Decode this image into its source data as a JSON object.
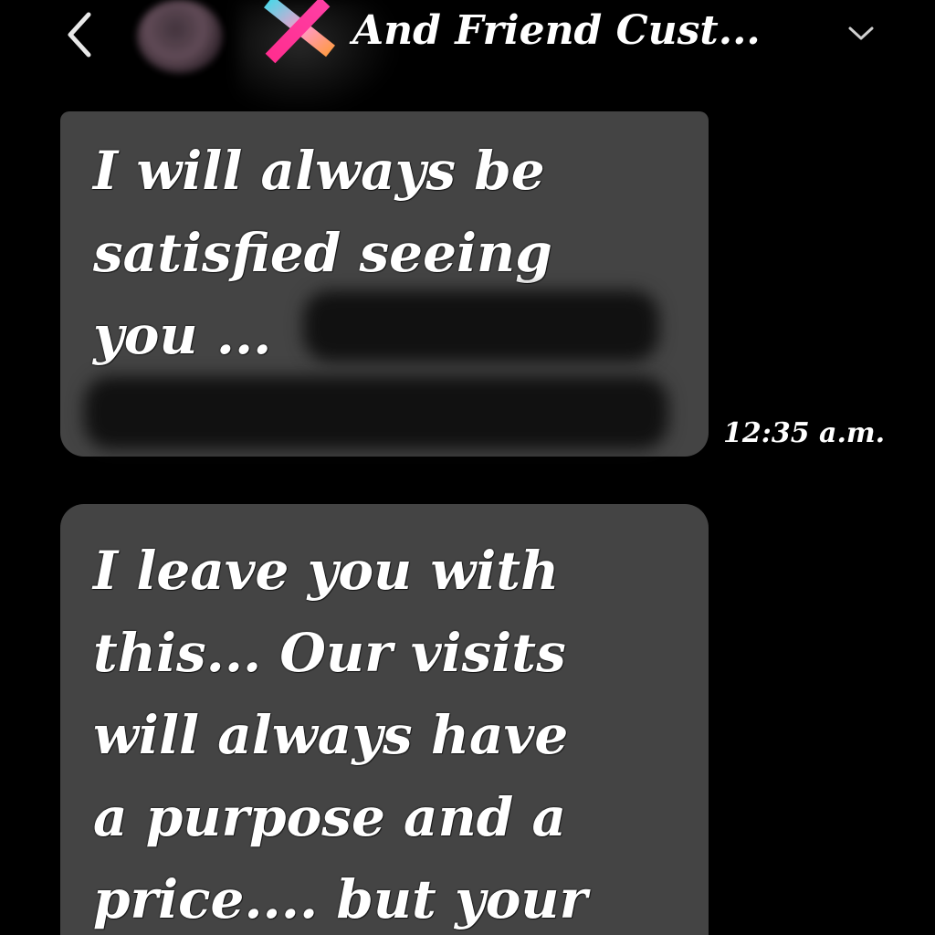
{
  "header": {
    "back_icon": "chevron-left-icon",
    "avatar_icon": "contact-avatar",
    "logo_icon": "x-logo-icon",
    "title": "And Friend Cust...",
    "dropdown_icon": "chevron-down-icon"
  },
  "messages": [
    {
      "text": "I will always be\nsatisfied seeing\nyou ...",
      "time": "12:35 a.m.",
      "redacted": true
    },
    {
      "text": "I leave you with\nthis... Our visits\nwill always have\na purpose and a\nprice.... but your",
      "redacted": false
    }
  ],
  "colors": {
    "background": "#000000",
    "bubble": "#444444",
    "text": "#ffffff",
    "logo_pink": "#ff3fa4",
    "logo_cyan": "#4fd6e8",
    "logo_orange": "#ff9a4a"
  }
}
